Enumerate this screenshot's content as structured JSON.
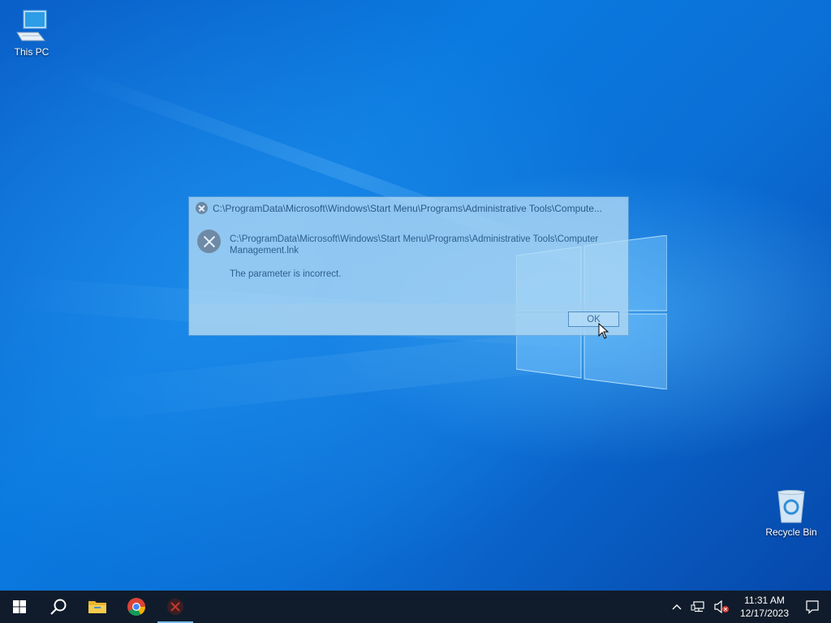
{
  "desktop": {
    "icons": [
      {
        "label": "This PC",
        "icon": "computer-icon"
      },
      {
        "label": "Recycle Bin",
        "icon": "recycle-bin-icon"
      }
    ]
  },
  "dialog": {
    "title": "C:\\ProgramData\\Microsoft\\Windows\\Start Menu\\Programs\\Administrative Tools\\Compute...",
    "path": "C:\\ProgramData\\Microsoft\\Windows\\Start Menu\\Programs\\Administrative Tools\\Computer Management.lnk",
    "message": "The parameter is incorrect.",
    "ok_label": "OK",
    "icon": "error-icon"
  },
  "taskbar": {
    "items": [
      {
        "name": "start",
        "icon": "windows-start-icon"
      },
      {
        "name": "search",
        "icon": "search-icon"
      },
      {
        "name": "file-explorer",
        "icon": "folder-icon"
      },
      {
        "name": "chrome",
        "icon": "chrome-icon"
      },
      {
        "name": "error-app",
        "icon": "error-icon",
        "active": true
      }
    ],
    "tray": {
      "time": "11:31 AM",
      "date": "12/17/2023",
      "icons": [
        "chevron-up-icon",
        "network-icon",
        "volume-muted-icon",
        "action-center-icon"
      ]
    }
  },
  "colors": {
    "taskbar": "#101c2b",
    "dialog_text": "#2f5f8d",
    "accent": "#76b9ed"
  }
}
